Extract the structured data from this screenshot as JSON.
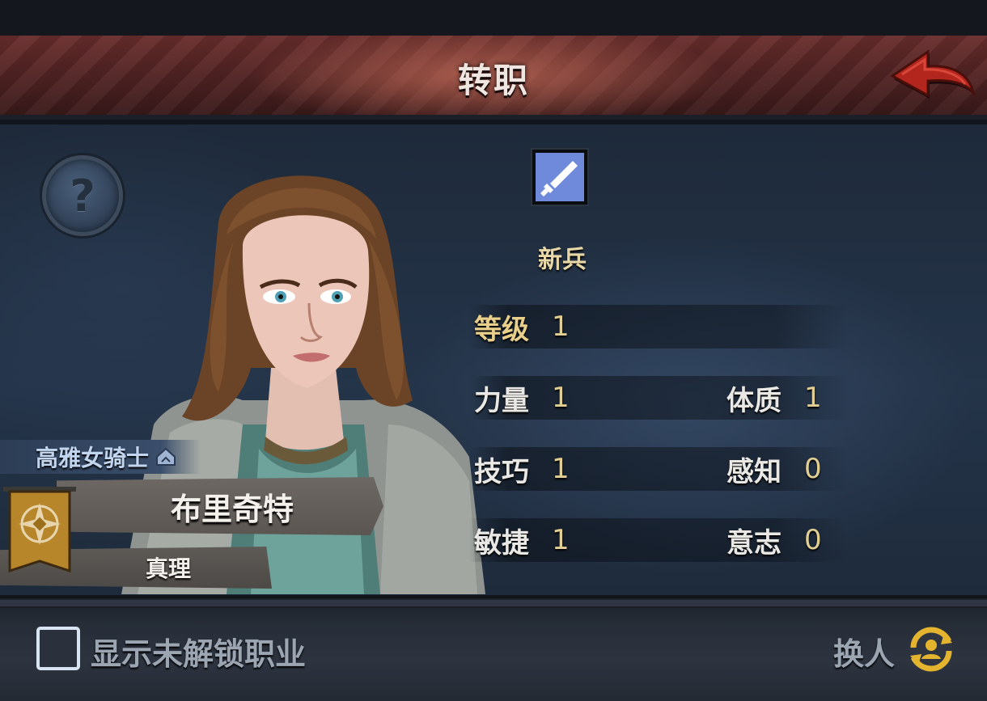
{
  "header": {
    "title": "转职",
    "back_icon": "back-arrow-icon"
  },
  "help": {
    "label": "?",
    "icon": "question-icon"
  },
  "job": {
    "icon": "dagger-icon",
    "name": "新兵",
    "icon_color": "#7a93e0"
  },
  "stats": {
    "level": {
      "label": "等级",
      "value": "1"
    },
    "strength": {
      "label": "力量",
      "value": "1"
    },
    "constitution": {
      "label": "体质",
      "value": "1"
    },
    "skill": {
      "label": "技巧",
      "value": "1"
    },
    "perception": {
      "label": "感知",
      "value": "0"
    },
    "agility": {
      "label": "敏捷",
      "value": "1"
    },
    "will": {
      "label": "意志",
      "value": "0"
    }
  },
  "character": {
    "title": "高雅女骑士",
    "name": "布里奇特",
    "faction": "真理",
    "emblem_color": "#b8862a"
  },
  "footer": {
    "show_locked_label": "显示未解锁职业",
    "show_locked_checked": false,
    "swap_label": "换人",
    "swap_icon": "swap-person-icon"
  },
  "colors": {
    "header_red": "#5a2626",
    "accent_gold": "#e8cf8a",
    "panel_blue": "#243449"
  }
}
